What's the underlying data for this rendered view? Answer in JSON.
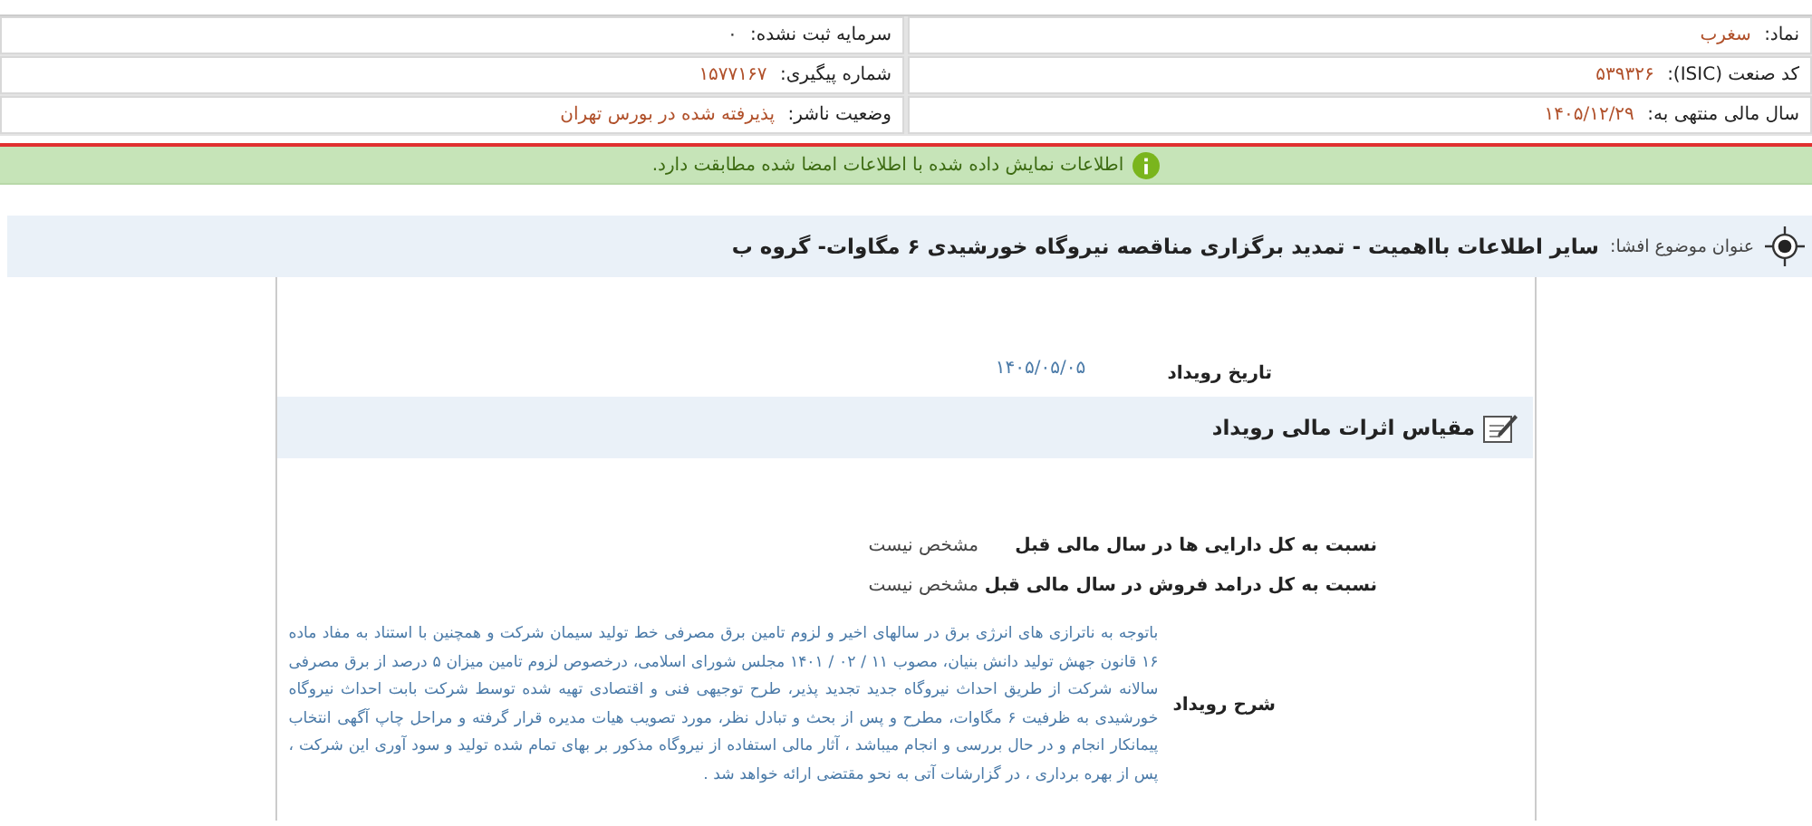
{
  "company_info": {
    "rows": [
      {
        "right": {
          "label": "نماد:",
          "value": "سغرب",
          "color": "#b0502a"
        },
        "left": {
          "label": "سرمایه ثبت نشده:",
          "value": "۰"
        }
      },
      {
        "right": {
          "label": "کد صنعت (ISIC):",
          "value": "۵۳۹۳۲۶",
          "color": "#b0502a"
        },
        "left": {
          "label": "شماره پیگیری:",
          "value": "۱۵۷۷۱۶۷",
          "color": "#b0502a"
        }
      },
      {
        "right": {
          "label": "سال مالی منتهی به:",
          "value": "۱۴۰۵/۱۲/۲۹",
          "color": "#b0502a"
        },
        "left": {
          "label": "وضعیت ناشر:",
          "value": "پذیرفته شده در بورس تهران",
          "color": "#b0502a"
        }
      }
    ]
  },
  "notice": {
    "text": "اطلاعات نمایش داده شده با اطلاعات امضا شده مطابقت دارد."
  },
  "subject": {
    "label": "عنوان موضوع افشا:",
    "title": "سایر اطلاعات بااهمیت - تمدید برگزاری مناقصه نیروگاه خورشیدی ۶ مگاوات- گروه ب"
  },
  "event_date": {
    "label": "تاریخ رویداد",
    "value": "۱۴۰۵/۰۵/۰۵"
  },
  "section": {
    "title": "مقیاس اثرات مالی رویداد"
  },
  "ratios": [
    {
      "label": "نسبت به کل دارایی ها در سال مالی قبل",
      "value": "مشخص نیست"
    },
    {
      "label": "نسبت به کل درامد فروش در سال مالی قبل",
      "value": "مشخص نیست"
    }
  ],
  "description": {
    "label": "شرح رویداد",
    "text": "باتوجه به ناترازی های انرژی برق در سالهای اخیر و لزوم تامین برق مصرفی خط تولید سیمان شرکت و همچنین با استناد به مفاد ماده ۱۶ قانون جهش تولید دانش بنیان، مصوب ۱۱ / ۰۲ / ۱۴۰۱ مجلس شورای اسلامی، درخصوص لزوم تامین میزان ۵ درصد از برق مصرفی سالانه شرکت از طریق احداث نیروگاه جدید تجدید پذیر، طرح توجیهی فنی و اقتصادی تهیه شده توسط شرکت بابت احداث نیروگاه خورشیدی به ظرفیت ۶ مگاوات، مطرح و پس از بحث و تبادل نظر، مورد تصویب هیات مدیره قرار گرفته و مراحل چاپ آگهی انتخاب پیمانکار انجام و در حال بررسی و انجام میباشد ، آثار مالی استفاده از نیروگاه مذکور بر بهای تمام شده تولید و سود آوری این شرکت ، پس از بهره برداری ، در گزارشات آتی به نحو مقتضی ارائه خواهد شد ."
  }
}
